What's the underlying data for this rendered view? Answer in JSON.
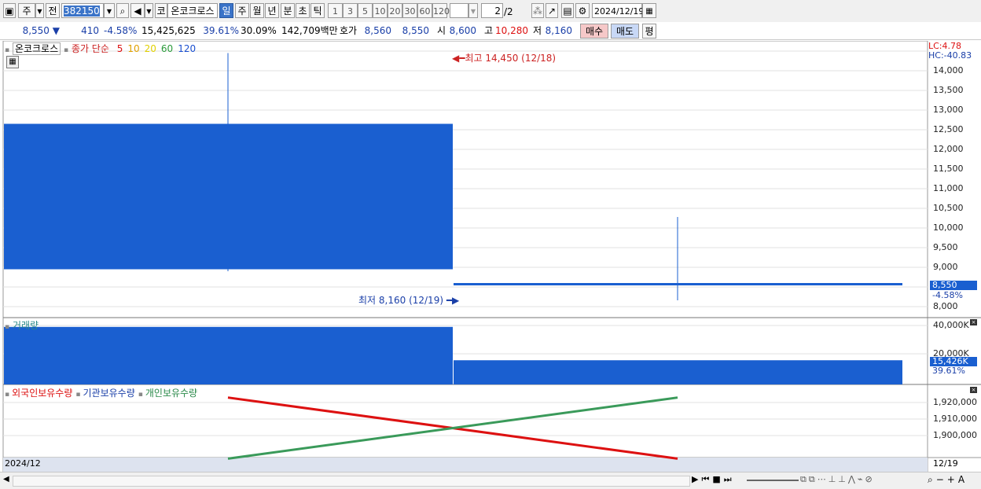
{
  "toolbar": {
    "market": "주",
    "prev": "전",
    "code": "382150",
    "code_label": "코",
    "name": "온코크로스",
    "periods": [
      "일",
      "주",
      "월",
      "년",
      "분",
      "초",
      "틱"
    ],
    "selected_period": "일",
    "intervals": [
      "1",
      "3",
      "5",
      "10",
      "20",
      "30",
      "60",
      "120"
    ],
    "page": "2",
    "page_total": "/2",
    "date": "2024/12/19"
  },
  "quote": {
    "price": "8,550",
    "arrow": "▼",
    "change": "410",
    "change_pct": "-4.58%",
    "volume": "15,425,625",
    "vol_ratio": "39.61%",
    "turnover": "30.09%",
    "amount": "142,709백만",
    "bid_label": "호가",
    "bid": "8,560",
    "ask": "8,550",
    "open_label": "시",
    "open": "8,600",
    "high_label": "고",
    "high": "10,280",
    "low_label": "저",
    "low": "8,160",
    "buy_label": "매수",
    "sell_label": "매도",
    "avg_label": "평"
  },
  "price_panel": {
    "legend_name": "온코크로스",
    "legend_ma": "종가 단순",
    "ma_periods": [
      "5",
      "10",
      "20",
      "60",
      "120"
    ],
    "ma_colors": [
      "#d11",
      "#e0a000",
      "#e0d000",
      "#2a9a3a",
      "#1a4fd0"
    ],
    "high_note": "최고 14,450 (12/18)",
    "low_note": "최저 8,160 (12/19)",
    "lc": "LC:4.78",
    "hc": "HC:-40.83",
    "y_ticks": [
      "14,000",
      "13,500",
      "13,000",
      "12,500",
      "12,000",
      "11,500",
      "11,000",
      "10,500",
      "10,000",
      "9,500",
      "9,000",
      "8,000"
    ],
    "current_price": "8,550",
    "current_pct": "-4.58%"
  },
  "volume_panel": {
    "label": "거래량",
    "y_ticks": [
      "40,000K",
      "20,000K"
    ],
    "current": "15,426K",
    "current_pct": "39.61%"
  },
  "holdings_panel": {
    "legend": [
      "외국인보유수량",
      "기관보유수량",
      "개인보유수량"
    ],
    "legend_colors": [
      "#d11",
      "#1a3fa8",
      "#2a8a4a"
    ],
    "y_ticks": [
      "1,920,000",
      "1,910,000",
      "1,900,000"
    ]
  },
  "x_axis": {
    "left_label": "2024/12",
    "right_label": "12/19"
  },
  "chart_data": {
    "type": "candlestick",
    "categories": [
      "12/18",
      "12/19"
    ],
    "candles": [
      {
        "date": "12/18",
        "open": 12650,
        "high": 14450,
        "low": 8900,
        "close": 8950
      },
      {
        "date": "12/19",
        "open": 8600,
        "high": 10280,
        "low": 8160,
        "close": 8550
      }
    ],
    "volume": [
      39000000,
      15425625
    ],
    "foreign_holdings": [
      1923000,
      1886000
    ],
    "individual_holdings": [
      1886000,
      1923000
    ]
  }
}
